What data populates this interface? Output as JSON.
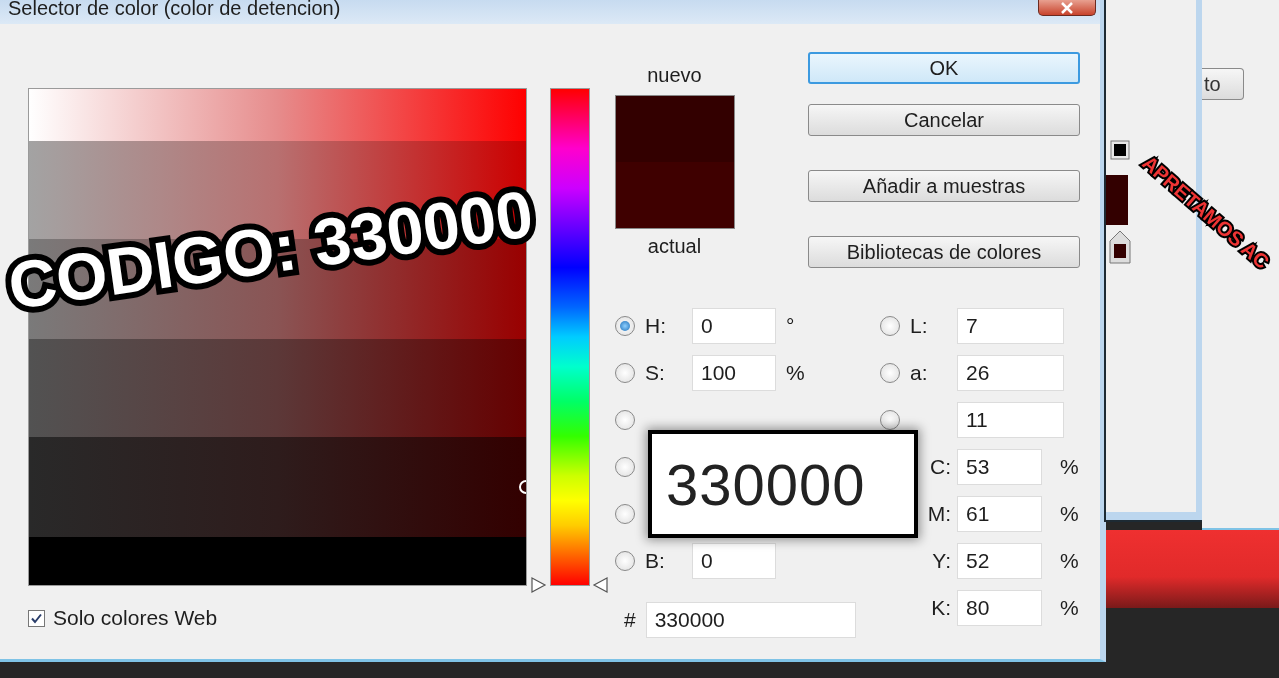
{
  "window": {
    "title": "Selector de color (color de detencion)"
  },
  "hue_slider": {
    "level": 0
  },
  "swatches": [
    {
      "label": "nuevo",
      "color": "#330000"
    },
    {
      "label": "actual",
      "color": "#3f0000"
    }
  ],
  "buttons": [
    {
      "label": "OK",
      "default": true
    },
    {
      "label": "Cancelar",
      "default": false
    },
    {
      "label": "Añadir a muestras",
      "default": false
    },
    {
      "label": "Bibliotecas de colores",
      "default": false
    }
  ],
  "hsb_rgb": [
    {
      "label": "H:",
      "value": "0",
      "unit": "°",
      "selected": true
    },
    {
      "label": "S:",
      "value": "100",
      "unit": "%",
      "selected": false
    },
    {
      "selected": false
    },
    {
      "selected": false
    },
    {
      "selected": false
    },
    {
      "label": "B:",
      "value": "0",
      "selected": false
    }
  ],
  "hex": {
    "label": "#",
    "value": "330000"
  },
  "lab_cmyk": [
    {
      "kind": "radio",
      "label": "L:",
      "value": "7",
      "selected": false
    },
    {
      "kind": "radio",
      "label": "a:",
      "value": "26",
      "selected": false
    },
    {
      "kind": "radio",
      "value": "11",
      "selected": false
    },
    {
      "kind": "plain",
      "label": "C:",
      "value": "53",
      "unit": "%"
    },
    {
      "kind": "plain",
      "label": "M:",
      "value": "61",
      "unit": "%"
    },
    {
      "kind": "plain",
      "label": "Y:",
      "value": "52",
      "unit": "%"
    },
    {
      "kind": "plain",
      "label": "K:",
      "value": "80",
      "unit": "%"
    }
  ],
  "web_only": {
    "label": "Solo colores Web",
    "checked": true
  },
  "background": {
    "button_label": "to"
  },
  "annotations": {
    "code_caption": "CODIGO: 330000",
    "zoom_inset": "330000",
    "pointer_caption": "APRETAMOS AC"
  }
}
